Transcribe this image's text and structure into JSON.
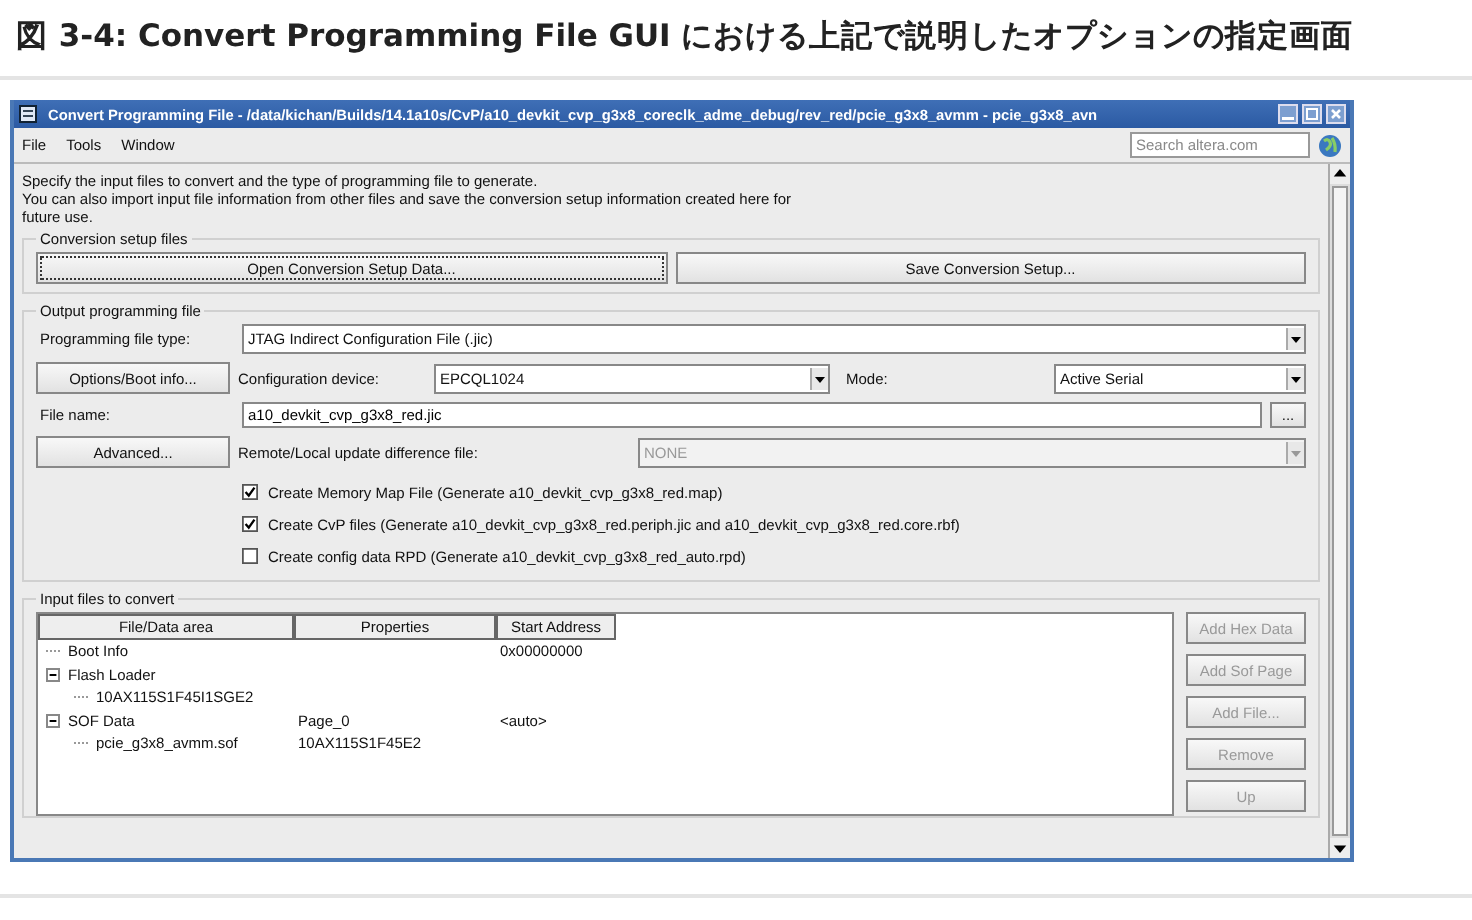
{
  "heading": "図 3-4: Convert Programming File GUI における上記で説明したオプションの指定画面",
  "window": {
    "title": "Convert Programming File - /data/kichan/Builds/14.1a10s/CvP/a10_devkit_cvp_g3x8_coreclk_adme_debug/rev_red/pcie_g3x8_avmm - pcie_g3x8_avn",
    "menu": [
      "File",
      "Tools",
      "Window"
    ],
    "search": {
      "placeholder": "Search altera.com"
    }
  },
  "intro": [
    "Specify the input files to convert and the type of programming file to generate.",
    "You can also import input file information from other files and save the conversion setup information created here for",
    "future use."
  ],
  "conversion_setup": {
    "title": "Conversion setup files",
    "buttons": [
      "Open Conversion Setup Data...",
      "Save Conversion Setup..."
    ]
  },
  "output": {
    "title": "Output programming file",
    "file_type": {
      "label": "Programming file type:",
      "value": "JTAG Indirect Configuration File (.jic)"
    },
    "options_button": "Options/Boot info...",
    "device": {
      "label": "Configuration device:",
      "value": "EPCQL1024"
    },
    "mode": {
      "label": "Mode:",
      "value": "Active Serial"
    },
    "file_name": {
      "label": "File name:",
      "value": "a10_devkit_cvp_g3x8_red.jic",
      "browse": "..."
    },
    "advanced_button": "Advanced...",
    "difference": {
      "label": "Remote/Local update difference file:",
      "value": "NONE",
      "disabled": true
    },
    "checkboxes": [
      {
        "label": "Create Memory Map File (Generate a10_devkit_cvp_g3x8_red.map)",
        "checked": true
      },
      {
        "label": "Create CvP files (Generate a10_devkit_cvp_g3x8_red.periph.jic and a10_devkit_cvp_g3x8_red.core.rbf)",
        "checked": true
      },
      {
        "label": "Create config data RPD (Generate a10_devkit_cvp_g3x8_red_auto.rpd)",
        "checked": false
      }
    ]
  },
  "input_files": {
    "title": "Input files to convert",
    "columns": [
      "File/Data area",
      "Properties",
      "Start Address"
    ],
    "rows": [
      {
        "name": "Boot Info",
        "start_address": "0x00000000"
      },
      {
        "name": "Flash Loader",
        "expanded": true,
        "children": [
          {
            "name": "10AX115S1F45I1SGE2"
          }
        ]
      },
      {
        "name": "SOF Data",
        "properties": "Page_0",
        "start_address": "<auto>",
        "expanded": true,
        "children": [
          {
            "name": "pcie_g3x8_avmm.sof",
            "properties": "10AX115S1F45E2"
          }
        ]
      }
    ],
    "side_buttons": [
      {
        "label": "Add Hex Data",
        "disabled": true
      },
      {
        "label": "Add Sof Page",
        "disabled": true
      },
      {
        "label": "Add File...",
        "disabled": true
      },
      {
        "label": "Remove",
        "disabled": true
      },
      {
        "label": "Up",
        "disabled": true
      }
    ]
  }
}
